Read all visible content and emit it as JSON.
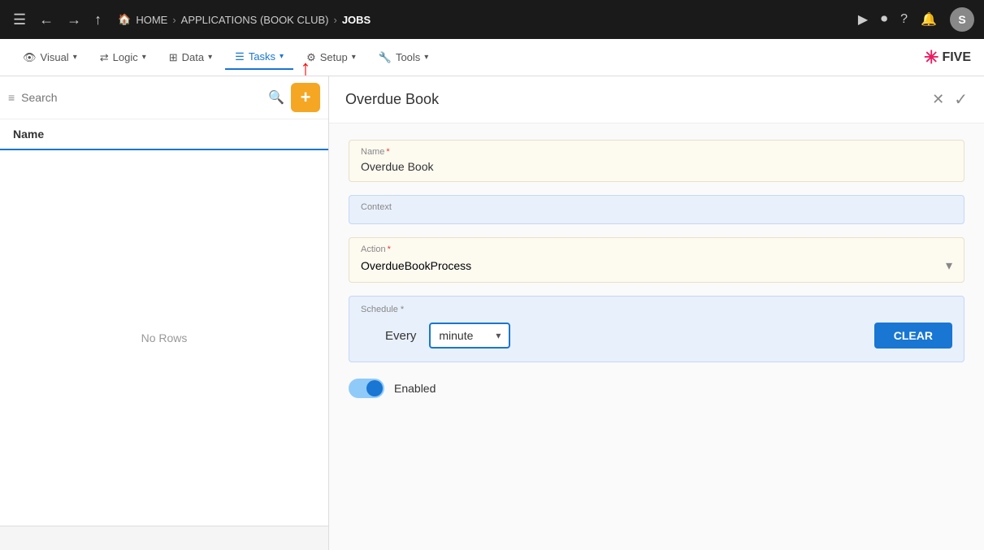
{
  "topNav": {
    "breadcrumb": {
      "home": "HOME",
      "app": "APPLICATIONS (BOOK CLUB)",
      "current": "JOBS"
    },
    "avatar": "S"
  },
  "secondaryNav": {
    "items": [
      {
        "id": "visual",
        "label": "Visual",
        "icon": "👁"
      },
      {
        "id": "logic",
        "label": "Logic",
        "icon": "🔀"
      },
      {
        "id": "data",
        "label": "Data",
        "icon": "⊞"
      },
      {
        "id": "tasks",
        "label": "Tasks",
        "icon": "☰",
        "active": true
      },
      {
        "id": "setup",
        "label": "Setup",
        "icon": "⚙"
      },
      {
        "id": "tools",
        "label": "Tools",
        "icon": "🔧"
      }
    ],
    "logo": "FIVE"
  },
  "leftPanel": {
    "search": {
      "placeholder": "Search"
    },
    "column": {
      "header": "Name"
    },
    "emptyMessage": "No Rows"
  },
  "rightPanel": {
    "title": "Overdue Book",
    "form": {
      "nameLabel": "Name",
      "nameRequired": "*",
      "nameValue": "Overdue Book",
      "contextLabel": "Context",
      "contextValue": "",
      "actionLabel": "Action",
      "actionRequired": "*",
      "actionValue": "OverdueBookProcess",
      "scheduleLabel": "Schedule *",
      "everyLabel": "Every",
      "minuteValue": "minute",
      "clearLabel": "CLEAR",
      "enabledLabel": "Enabled"
    }
  }
}
